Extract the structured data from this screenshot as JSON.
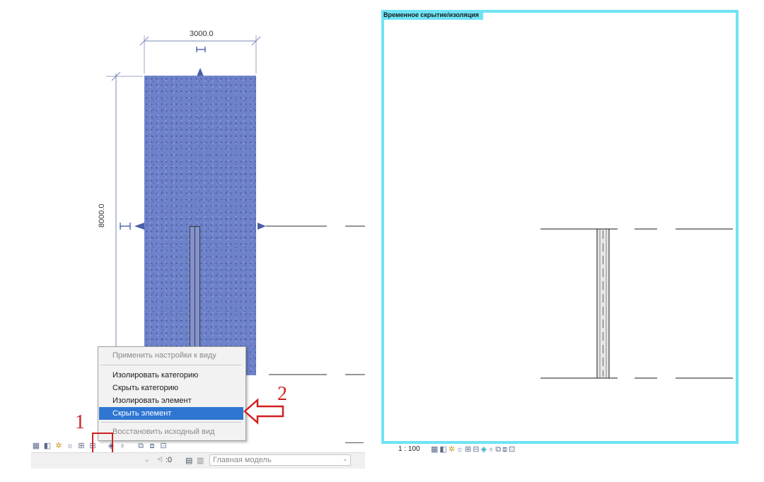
{
  "left_view": {
    "dim_horizontal": "3000.0",
    "dim_vertical": "8000.0"
  },
  "context_menu": {
    "items": [
      {
        "label": "Применить настройки к виду",
        "state": "disabled"
      },
      {
        "label": "Изолировать категорию",
        "state": "normal"
      },
      {
        "label": "Скрыть категорию",
        "state": "normal"
      },
      {
        "label": "Изолировать элемент",
        "state": "normal"
      },
      {
        "label": "Скрыть элемент",
        "state": "highlighted"
      },
      {
        "label": "Восстановить исходный вид",
        "state": "disabled"
      }
    ]
  },
  "annotations": {
    "marker_1": "1",
    "marker_2": "2",
    "color": "#d02020"
  },
  "status_bar": {
    "counter": ":0",
    "model_select": "Главная модель"
  },
  "right_view": {
    "title": "Временное скрытие/изоляция",
    "title_color": "#6ee3f5",
    "scale": "1 : 100"
  },
  "colors": {
    "concrete": "#6d82c9",
    "menu_highlight": "#2f76d2"
  }
}
